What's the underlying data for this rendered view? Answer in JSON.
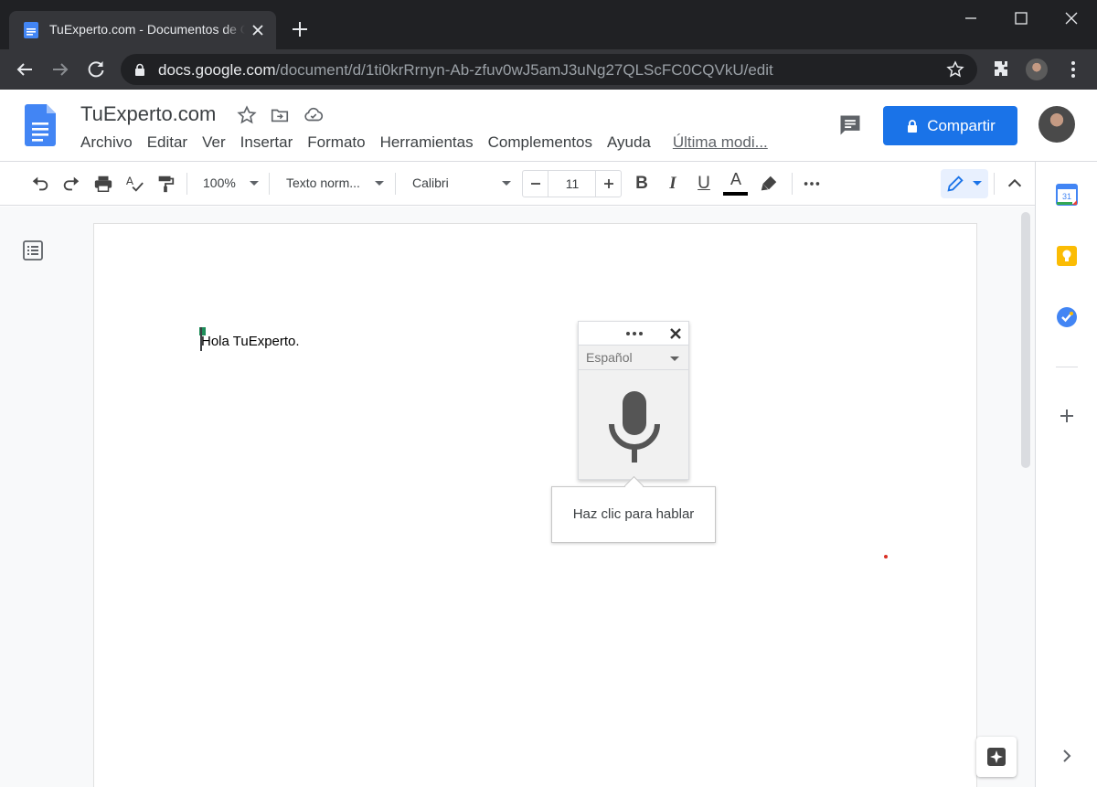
{
  "browser": {
    "tab_title": "TuExperto.com - Documentos de Google",
    "url_host": "docs.google.com",
    "url_path": "/document/d/1ti0krRrnyn-Ab-zfuv0wJ5amJ3uNg27QLScFC0CQVkU/edit"
  },
  "docs": {
    "title": "TuExperto.com",
    "menu": [
      "Archivo",
      "Editar",
      "Ver",
      "Insertar",
      "Formato",
      "Herramientas",
      "Complementos",
      "Ayuda"
    ],
    "last_edit": "Última modi...",
    "share_label": "Compartir"
  },
  "toolbar": {
    "zoom": "100%",
    "style": "Texto norm...",
    "font": "Calibri",
    "font_size": "11",
    "bold": "B",
    "italic": "I",
    "underline": "U",
    "text_color": "A"
  },
  "document": {
    "body_text": "Hola TuExperto."
  },
  "voice_typing": {
    "language": "Español",
    "tooltip": "Haz clic para hablar"
  },
  "side_panel": {
    "apps": [
      "calendar-icon",
      "keep-icon",
      "tasks-icon",
      "add-icon"
    ],
    "calendar_day": "31"
  },
  "colors": {
    "accent_blue": "#1a73e8",
    "chrome_dark": "#202124",
    "chrome_tab": "#35363a"
  }
}
